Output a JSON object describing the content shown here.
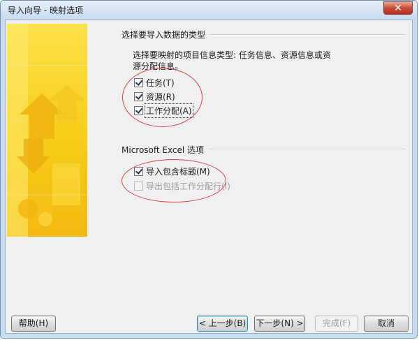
{
  "window": {
    "title": "导入向导 - 映射选项",
    "close_glyph": "✕"
  },
  "section_data_type": {
    "title": "选择要导入数据的类型",
    "description": "选择要映射的项目信息类型: 任务信息、资源信息或资源分配信息。",
    "options": [
      {
        "label": "任务(T)",
        "checked": true
      },
      {
        "label": "资源(R)",
        "checked": true
      },
      {
        "label": "工作分配(A)",
        "checked": true
      }
    ]
  },
  "section_excel": {
    "title": "Microsoft Excel 选项",
    "options": [
      {
        "label": "导入包含标题(M)",
        "checked": true,
        "enabled": true
      },
      {
        "label": "导出包括工作分配行(I)",
        "checked": false,
        "enabled": false
      }
    ]
  },
  "buttons": {
    "help": "帮助(H)",
    "back": "< 上一步(B)",
    "next": "下一步(N) >",
    "finish": "完成(F)",
    "cancel": "取消"
  },
  "colors": {
    "banner_yellow": "#f7d21e",
    "annotation_red": "#d93f3f"
  }
}
